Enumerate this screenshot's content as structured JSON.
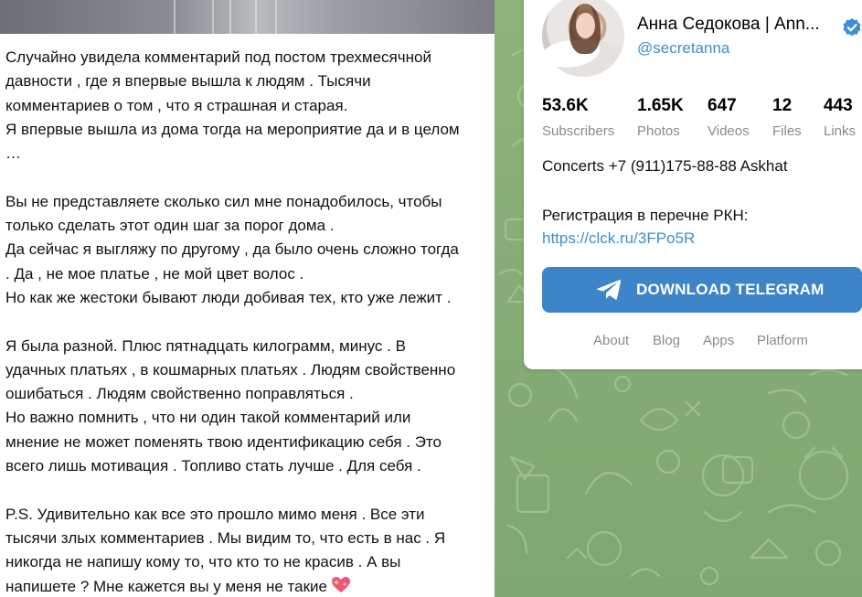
{
  "post": {
    "lines": [
      "Случайно увидела комментарий под постом трехмесячной",
      "давности , где я впервые вышла к людям . Тысячи",
      "комментариев о том , что я страшная и старая.",
      "Я впервые вышла из дома тогда на мероприятие да и в целом",
      "…",
      "",
      "Вы не представляете сколько сил мне понадобилось, чтобы",
      "только сделать этот один шаг за порог дома .",
      "Да сейчас я выгляжу по другому , да было очень сложно тогда",
      ". Да , не мое платье , не мой цвет волос .",
      "Но как же жестоки бывают люди добивая тех, кто уже лежит .",
      "",
      "Я была разной. Плюс пятнадцать килограмм, минус . В",
      "удачных платьях , в кошмарных платьях . Людям свойственно",
      "ошибаться . Людям свойственно поправляться .",
      "Но важно помнить , что ни один такой комментарий или",
      "мнение не может поменять твою идентификацию себя . Это",
      "всего лишь мотивация . Топливо стать лучше . Для себя .",
      "",
      "P.S. Удивительно как все это прошло мимо меня . Все эти",
      "тысячи злых комментариев . Мы видим то, что есть в нас . Я",
      "никогда не напишу кому то, что кто то не красив . А вы",
      "напишете ? Мне кажется вы у меня не такие"
    ],
    "emoji_icon": "sparkling-heart-icon"
  },
  "channel": {
    "name": "Анна Седокова | Ann...",
    "handle": "@secretanna",
    "verified_icon": "verified-badge-icon",
    "stats": [
      {
        "value": "53.6K",
        "label": "Subscribers"
      },
      {
        "value": "1.65K",
        "label": "Photos"
      },
      {
        "value": "647",
        "label": "Videos"
      },
      {
        "value": "12",
        "label": "Files"
      },
      {
        "value": "443",
        "label": "Links"
      }
    ],
    "description_line1": "Concerts +7 (911)175-88-88 Askhat",
    "description_line2": "Регистрация в перечне РКН:",
    "description_link": "https://clck.ru/3FPo5R"
  },
  "download": {
    "label": "DOWNLOAD TELEGRAM",
    "icon": "telegram-plane-icon"
  },
  "footer": {
    "about": "About",
    "blog": "Blog",
    "apps": "Apps",
    "platform": "Platform"
  },
  "colors": {
    "accent": "#3d84c9",
    "link": "#3a8fd0",
    "background_pattern": "#86ad76",
    "muted_text": "#8a8a8a"
  }
}
